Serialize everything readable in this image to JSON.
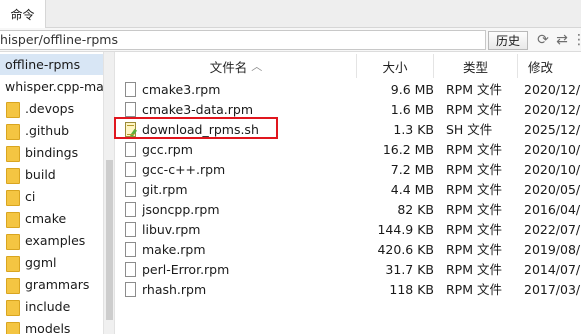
{
  "top_tab": {
    "label": "命令"
  },
  "path_bar": {
    "path": "hisper/offline-rpms",
    "history_button": "历史"
  },
  "tree": {
    "items": [
      {
        "label": "offline-rpms",
        "selected": true,
        "icon": "none"
      },
      {
        "label": "whisper.cpp-ma",
        "selected": false,
        "icon": "none"
      },
      {
        "label": ".devops",
        "selected": false,
        "icon": "folder-icon"
      },
      {
        "label": ".github",
        "selected": false,
        "icon": "folder-icon"
      },
      {
        "label": "bindings",
        "selected": false,
        "icon": "folder-icon"
      },
      {
        "label": "build",
        "selected": false,
        "icon": "folder-icon"
      },
      {
        "label": "ci",
        "selected": false,
        "icon": "folder-icon"
      },
      {
        "label": "cmake",
        "selected": false,
        "icon": "folder-icon"
      },
      {
        "label": "examples",
        "selected": false,
        "icon": "folder-icon"
      },
      {
        "label": "ggml",
        "selected": false,
        "icon": "folder-icon"
      },
      {
        "label": "grammars",
        "selected": false,
        "icon": "folder-icon"
      },
      {
        "label": "include",
        "selected": false,
        "icon": "folder-icon"
      },
      {
        "label": "models",
        "selected": false,
        "icon": "folder-icon"
      }
    ]
  },
  "list": {
    "columns": {
      "name": "文件名",
      "size": "大小",
      "type": "类型",
      "modified": "修改"
    },
    "rows": [
      {
        "name": "cmake3.rpm",
        "size": "9.6 MB",
        "type": "RPM 文件",
        "modified": "2020/12/",
        "icon": "file-icon"
      },
      {
        "name": "cmake3-data.rpm",
        "size": "1.6 MB",
        "type": "RPM 文件",
        "modified": "2020/12/",
        "icon": "file-icon"
      },
      {
        "name": "download_rpms.sh",
        "size": "1.3 KB",
        "type": "SH 文件",
        "modified": "2025/12/",
        "icon": "script-file-icon"
      },
      {
        "name": "gcc.rpm",
        "size": "16.2 MB",
        "type": "RPM 文件",
        "modified": "2020/10/",
        "icon": "file-icon"
      },
      {
        "name": "gcc-c++.rpm",
        "size": "7.2 MB",
        "type": "RPM 文件",
        "modified": "2020/10/",
        "icon": "file-icon"
      },
      {
        "name": "git.rpm",
        "size": "4.4 MB",
        "type": "RPM 文件",
        "modified": "2020/05/",
        "icon": "file-icon"
      },
      {
        "name": "jsoncpp.rpm",
        "size": "82 KB",
        "type": "RPM 文件",
        "modified": "2016/04/",
        "icon": "file-icon"
      },
      {
        "name": "libuv.rpm",
        "size": "144.9 KB",
        "type": "RPM 文件",
        "modified": "2022/07/",
        "icon": "file-icon"
      },
      {
        "name": "make.rpm",
        "size": "420.6 KB",
        "type": "RPM 文件",
        "modified": "2019/08/",
        "icon": "file-icon"
      },
      {
        "name": "perl-Error.rpm",
        "size": "31.7 KB",
        "type": "RPM 文件",
        "modified": "2014/07/",
        "icon": "file-icon"
      },
      {
        "name": "rhash.rpm",
        "size": "118 KB",
        "type": "RPM 文件",
        "modified": "2017/03/",
        "icon": "file-icon"
      }
    ]
  },
  "colors": {
    "highlight": "#e0161e",
    "selection": "#d8e6f5",
    "folder": "#f4c542"
  }
}
